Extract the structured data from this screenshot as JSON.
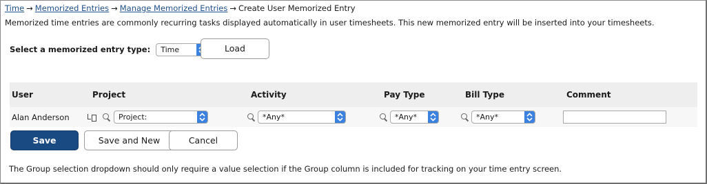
{
  "breadcrumb": {
    "items": [
      "Time",
      "Memorized Entries",
      "Manage Memorized Entries"
    ],
    "separator": "→",
    "current": "Create User Memorized Entry"
  },
  "intro_text": "Memorized time entries are commonly recurring tasks displayed automatically in user timesheets. This new memorized entry will be inserted into your timesheets.",
  "entry_type": {
    "label": "Select a memorized entry type:",
    "selected": "Time",
    "load_label": "Load"
  },
  "table": {
    "headers": [
      "User",
      "Project",
      "Activity",
      "Pay Type",
      "Bill Type",
      "Comment"
    ],
    "row": {
      "user": "Alan Anderson",
      "project": "Project:",
      "activity": "*Any*",
      "pay_type": "*Any*",
      "bill_type": "*Any*",
      "comment": ""
    }
  },
  "buttons": {
    "save": "Save",
    "save_and_new": "Save and New",
    "cancel": "Cancel"
  },
  "note": "The Group selection dropdown should only require a value selection if the Group column is included for tracking on your time entry screen.",
  "colors": {
    "link": "#1f4f8a",
    "select_button": "#3b82e0",
    "save_button": "#1a4a82"
  },
  "icons": [
    "magnifier-icon",
    "project-tree-icon",
    "select-arrows-icon"
  ]
}
